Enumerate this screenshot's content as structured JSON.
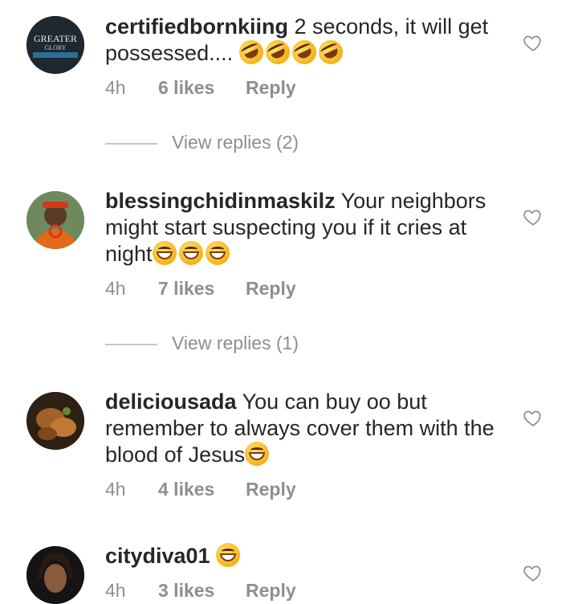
{
  "comments": [
    {
      "username": "certifiedbornkiing",
      "text": " 2 seconds, it will get possessed....",
      "emojis": [
        "rofl-emoji",
        "rofl-emoji",
        "rofl-emoji",
        "rofl-emoji"
      ],
      "time": "4h",
      "likes": "6 likes",
      "reply": "Reply",
      "view_replies": "View replies (2)",
      "avatar": "greater-glory-logo-avatar"
    },
    {
      "username": "blessingchidinmaskilz",
      "text": " Your neighbors might start suspecting you if it cries at night",
      "emojis": [
        "grin-emoji",
        "grin-emoji",
        "grin-emoji"
      ],
      "time": "4h",
      "likes": "7 likes",
      "reply": "Reply",
      "view_replies": "View replies (1)",
      "avatar": "woman-portrait-avatar"
    },
    {
      "username": "deliciousada",
      "text": " You can buy oo but remember to always cover them with the blood of Jesus",
      "emojis": [
        "grin-emoji"
      ],
      "time": "4h",
      "likes": "4 likes",
      "reply": "Reply",
      "avatar": "food-avatar"
    },
    {
      "username": "citydiva01",
      "text": " ",
      "emojis": [
        "grin-emoji"
      ],
      "time": "4h",
      "likes": "3 likes",
      "reply": "Reply",
      "avatar": "woman-portrait-avatar"
    }
  ],
  "icons": {
    "like": "heart-outline-icon"
  },
  "colors": {
    "text": "#262626",
    "muted": "#8e8e8e",
    "divider": "#c7c7c7"
  }
}
